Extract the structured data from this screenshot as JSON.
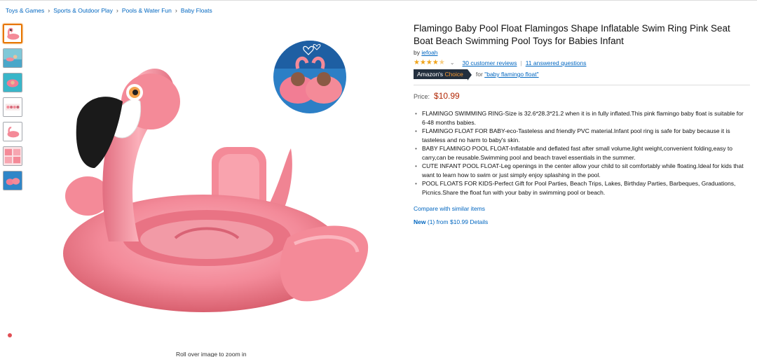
{
  "breadcrumb": [
    "Toys & Games",
    "Sports & Outdoor Play",
    "Pools & Water Fun",
    "Baby Floats"
  ],
  "breadcrumb_sep": "›",
  "product": {
    "title": "Flamingo Baby Pool Float Flamingos Shape Inflatable Swim Ring Pink Seat Boat Beach Swimming Pool Toys for Babies Infant",
    "by_label": "by",
    "brand": "iefoah",
    "rating": 4.5,
    "reviews_link": "30 customer reviews",
    "questions_link": "11 answered questions",
    "choice_badge_prefix": "Amazon's",
    "choice_badge_suffix": "Choice",
    "choice_for_label": "for",
    "choice_for_query": "\"baby flamingo float\"",
    "price_label": "Price:",
    "price": "$10.99",
    "bullets": [
      "FLAMINGO SWIMMING RING-Size is 32.6*28.3*21.2 when it is in fully inflated.This pink flamingo baby float is suitable for 6-48 months babies.",
      "FLAMINGO FLOAT FOR BABY-eco-Tasteless and friendly PVC material.Infant pool ring is safe for baby because it is tasteless and no harm to baby's skin.",
      "BABY FLAMINGO POOL FLOAT-Inflatable and deflated fast after small volume,light weight,convenient folding,easy to carry,can be reusable.Swimming pool and beach travel essentials in the summer.",
      "CUTE INFANT POOL FLOAT-Leg openings in the center allow your child to sit comfortably while floating.Ideal for kids that want to learn how to swim or just simply enjoy splashing in the pool.",
      "POOL FLOATS FOR KIDS-Perfect Gift for Pool Parties, Beach Trips, Lakes, Birthday Parties, Barbeques, Graduations, Picnics.Share the float fun with your baby in swimming pool or beach."
    ],
    "compare_link": "Compare with similar items",
    "new_label": "New",
    "new_rest": "(1) from $10.99 Details"
  },
  "gallery": {
    "rollover_hint": "Roll over image to zoom in",
    "thumb_count": 7
  },
  "colors": {
    "link": "#0066c0",
    "price": "#b12704",
    "badge_bg": "#232f3e",
    "star": "#f0a41b",
    "flamingo_pink": "#f48a98"
  }
}
